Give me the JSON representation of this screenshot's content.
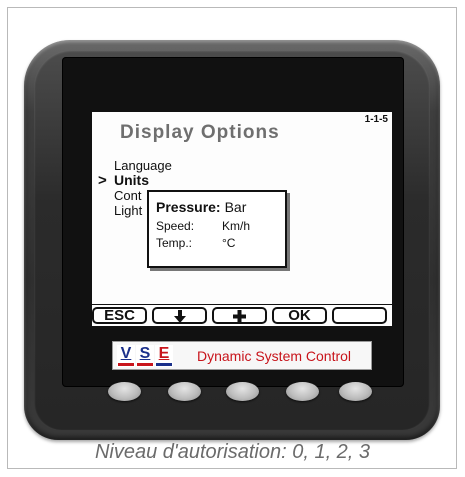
{
  "screen": {
    "title": "Display Options",
    "code": "1-1-5",
    "menu": [
      {
        "label": "Language",
        "selected": false
      },
      {
        "label": "Units",
        "selected": true
      },
      {
        "label": "Cont",
        "selected": false
      },
      {
        "label": "Light",
        "selected": false
      }
    ],
    "selector_glyph": ">"
  },
  "popup": {
    "pressure_label": "Pressure:",
    "pressure_value": "Bar",
    "speed_label": "Speed:",
    "speed_value": "Km/h",
    "temp_label": "Temp.:",
    "temp_value": "°C"
  },
  "softkeys": {
    "esc": "ESC",
    "down_icon": "arrow-down-icon",
    "plus_icon": "plus-icon",
    "ok": "OK",
    "empty": ""
  },
  "brand": {
    "logo_letters": [
      "V",
      "S",
      "E"
    ],
    "text": "Dynamic System Control",
    "colors": {
      "blue": "#1a2f8a",
      "red": "#c8141b"
    }
  },
  "caption": "Niveau d'autorisation: 0, 1, 2, 3"
}
